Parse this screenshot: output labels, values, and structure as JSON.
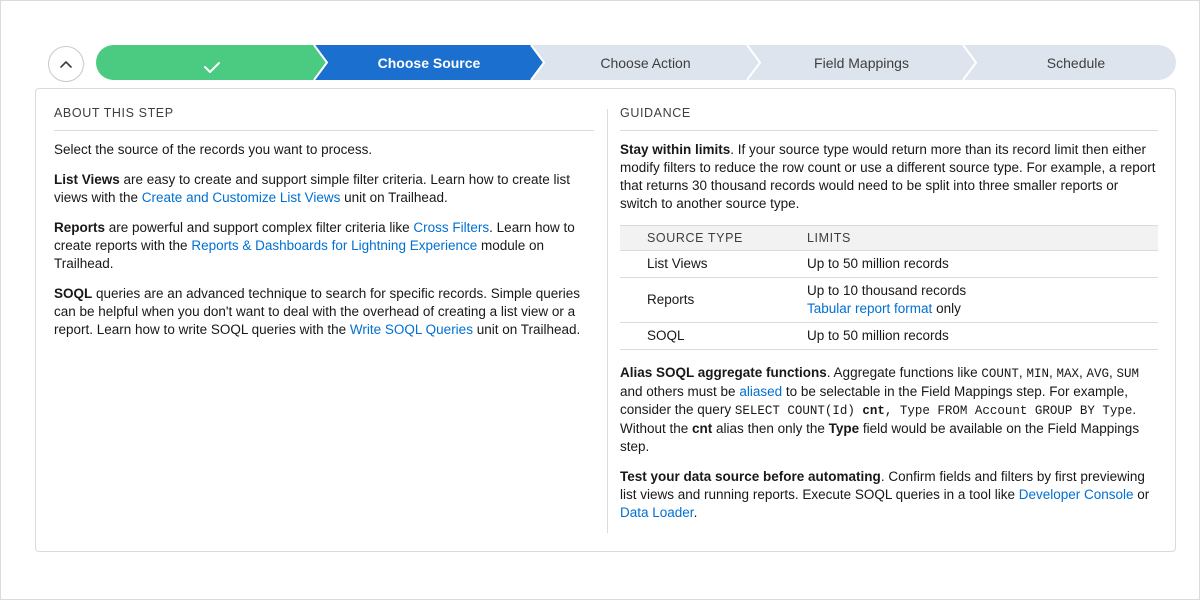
{
  "path": {
    "stages": [
      {
        "label": "",
        "status": "complete"
      },
      {
        "label": "Choose Source",
        "status": "current"
      },
      {
        "label": "Choose Action",
        "status": "incomplete"
      },
      {
        "label": "Field Mappings",
        "status": "incomplete"
      },
      {
        "label": "Schedule",
        "status": "incomplete"
      }
    ],
    "colors": {
      "complete": "#4bca81",
      "current": "#1b6fcf",
      "incomplete": "#dee4ee"
    }
  },
  "about": {
    "title": "ABOUT THIS STEP",
    "intro": "Select the source of the records you want to process.",
    "list_views": {
      "term": "List Views",
      "text1": " are easy to create and support simple filter criteria. Learn how to create list views with the ",
      "link": "Create and Customize List Views",
      "text2": " unit on Trailhead."
    },
    "reports": {
      "term": "Reports",
      "text1": " are powerful and support complex filter criteria like ",
      "link1": "Cross Filters",
      "text2": ". Learn how to create reports with the ",
      "link2": "Reports & Dashboards for Lightning Experience",
      "text3": " module on Trailhead."
    },
    "soql": {
      "term": "SOQL",
      "text1": " queries are an advanced technique to search for specific records. Simple queries can be helpful when you don't want to deal with the overhead of creating a list view or a report. Learn how to write SOQL queries with the ",
      "link": "Write SOQL Queries",
      "text2": " unit on Trailhead."
    }
  },
  "guidance": {
    "title": "GUIDANCE",
    "limits": {
      "term": "Stay within limits",
      "text": ". If your source type would return more than its record limit then either modify filters to reduce the row count or use a different source type. For example, a report that returns 30 thousand records would need to be split into three smaller reports or switch to another source type."
    },
    "table": {
      "headers": [
        "SOURCE TYPE",
        "LIMITS"
      ],
      "rows": [
        {
          "type": "List Views",
          "limit": "Up to 50 million records"
        },
        {
          "type": "Reports",
          "limit": "Up to 10 thousand records",
          "limit_link": "Tabular report format",
          "limit_suffix": " only"
        },
        {
          "type": "SOQL",
          "limit": "Up to 50 million records"
        }
      ]
    },
    "alias": {
      "term": "Alias SOQL aggregate functions",
      "t1": ". Aggregate functions like ",
      "c1": "COUNT",
      "t2": ", ",
      "c2": "MIN",
      "t3": ", ",
      "c3": "MAX",
      "t4": ", ",
      "c4": "AVG",
      "t5": ", ",
      "c5": "SUM",
      "t6": " and others must be ",
      "link": "aliased",
      "t7": " to be selectable in the Field Mappings step. For example, consider the query ",
      "q1": "SELECT COUNT(Id) ",
      "q2": "cnt",
      "q3": ", Type FROM Account GROUP BY Type",
      "t8": ". Without the ",
      "b1": "cnt",
      "t9": " alias then only the ",
      "b2": "Type",
      "t10": " field would be available on the Field Mappings step."
    },
    "test": {
      "term": "Test your data source before automating",
      "text": ". Confirm fields and filters by first previewing list views and running reports. Execute SOQL queries in a tool like ",
      "link1": "Developer Console",
      "mid": " or ",
      "link2": "Data Loader",
      "end": "."
    }
  },
  "icons": {
    "collapse": "chevron-up-icon",
    "complete": "check-icon"
  }
}
